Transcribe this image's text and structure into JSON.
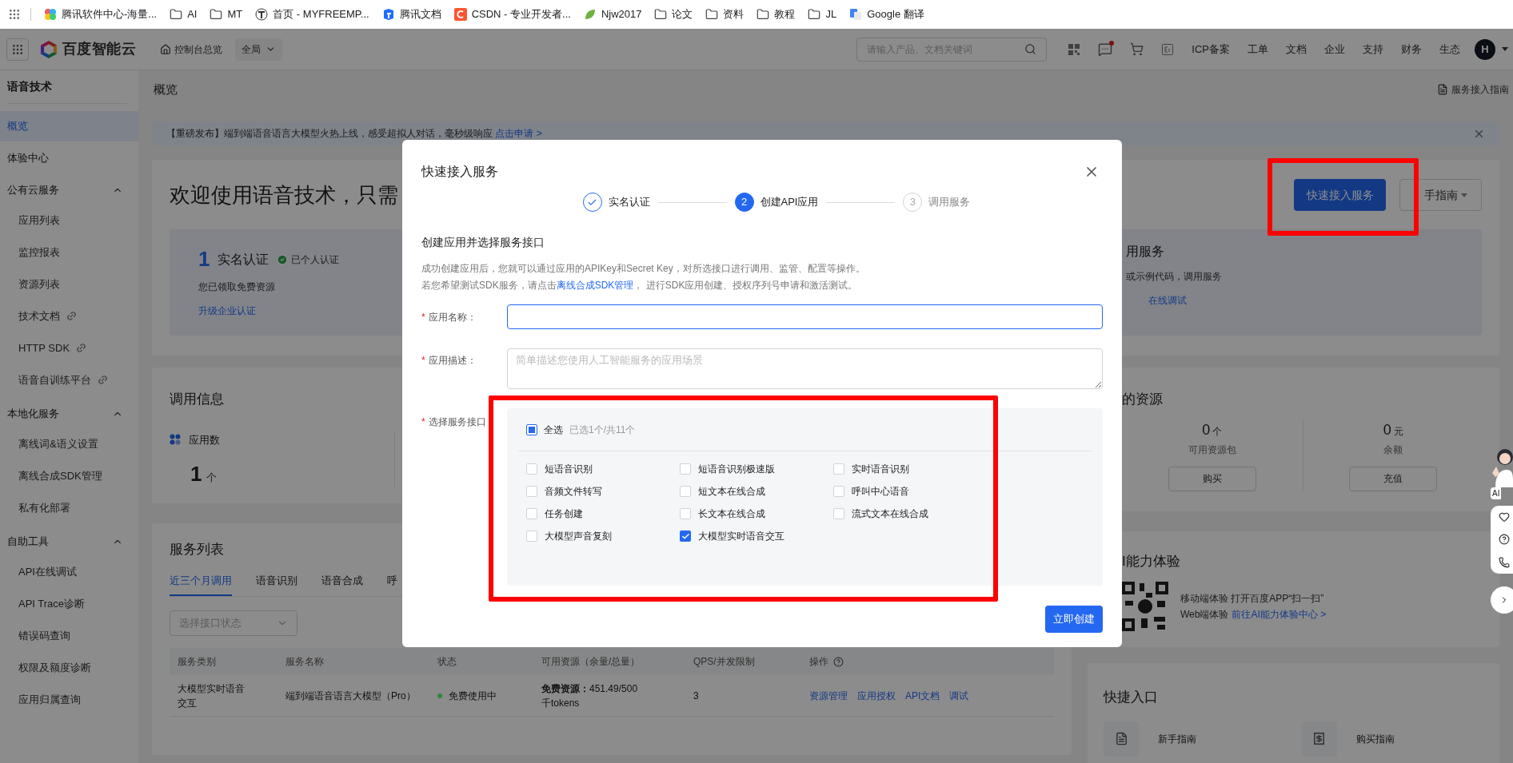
{
  "bookmarks": [
    {
      "label": "腾讯软件中心-海量...",
      "kind": "site"
    },
    {
      "label": "AI",
      "kind": "folder"
    },
    {
      "label": "MT",
      "kind": "folder"
    },
    {
      "label": "首页 - MYFREEMP...",
      "kind": "site"
    },
    {
      "label": "腾讯文档",
      "kind": "site"
    },
    {
      "label": "CSDN - 专业开发者...",
      "kind": "site"
    },
    {
      "label": "Njw2017",
      "kind": "site"
    },
    {
      "label": "论文",
      "kind": "folder"
    },
    {
      "label": "资料",
      "kind": "folder"
    },
    {
      "label": "教程",
      "kind": "folder"
    },
    {
      "label": "JL",
      "kind": "folder"
    },
    {
      "label": "Google 翻译",
      "kind": "site"
    }
  ],
  "header": {
    "logo": "百度智能云",
    "console": "控制台总览",
    "scope": "全局",
    "search_placeholder": "请输入产品、文档关键词",
    "message_unread": true,
    "nav": [
      "ICP备案",
      "工单",
      "文档",
      "企业",
      "支持",
      "财务",
      "生态"
    ],
    "avatar": "H"
  },
  "sidebar": {
    "title": "语音技术",
    "items": [
      {
        "label": "概览",
        "selected": true
      },
      {
        "label": "体验中心",
        "selected": false
      },
      {
        "label": "公有云服务",
        "selected": false,
        "expanded": true,
        "children": [
          {
            "label": "应用列表",
            "external": false
          },
          {
            "label": "监控报表",
            "external": false
          },
          {
            "label": "资源列表",
            "external": false
          },
          {
            "label": "技术文档",
            "external": true
          },
          {
            "label": "HTTP SDK",
            "external": true
          },
          {
            "label": "语音自训练平台",
            "external": true
          }
        ]
      },
      {
        "label": "本地化服务",
        "selected": false,
        "expanded": true,
        "children": [
          {
            "label": "离线词&语义设置",
            "external": false
          },
          {
            "label": "离线合成SDK管理",
            "external": false
          },
          {
            "label": "私有化部署",
            "external": false
          }
        ]
      },
      {
        "label": "自助工具",
        "selected": false,
        "expanded": true,
        "children": [
          {
            "label": "API在线调试",
            "external": false
          },
          {
            "label": "API Trace诊断",
            "external": false
          },
          {
            "label": "错误码查询",
            "external": false
          },
          {
            "label": "权限及额度诊断",
            "external": false
          },
          {
            "label": "应用归属查询",
            "external": false
          }
        ]
      }
    ]
  },
  "page": {
    "title": "概览",
    "guide_link": "服务接入指南",
    "banner": {
      "text": "【重磅发布】端到端语音语言大模型火热上线，感受超拟人对话，毫秒级响应",
      "link": "点击申请 >"
    },
    "welcome": {
      "title": "欢迎使用语音技术，只需",
      "primary_button": "快速接入服务",
      "guide_button": "手指南",
      "step_cards": [
        {
          "number": "1",
          "title": "实名认证",
          "status": "已个人认证",
          "text": "您已领取免费资源",
          "link": "升级企业认证"
        },
        {
          "title": "用服务",
          "text": "或示例代码，调用服务",
          "link": "在线调试"
        }
      ]
    },
    "usage": {
      "title": "调用信息",
      "metric": "应用数",
      "value": "1",
      "unit": "个"
    },
    "services": {
      "title": "服务列表",
      "tabs": [
        {
          "label": "近三个月调用",
          "selected": true
        },
        {
          "label": "语音识别",
          "selected": false
        },
        {
          "label": "语音合成",
          "selected": false
        },
        {
          "label": "呼",
          "selected": false
        }
      ],
      "filter_placeholder": "选择接口状态",
      "columns": [
        {
          "label": "服务类别",
          "help": false
        },
        {
          "label": "服务名称",
          "help": false
        },
        {
          "label": "状态",
          "help": false
        },
        {
          "label": "可用资源（余量/总量）",
          "help": false
        },
        {
          "label": "QPS/并发限制",
          "help": false
        },
        {
          "label": "操作",
          "help": true
        }
      ],
      "rows": [
        {
          "category": "大模型实时语音交互",
          "name": "端到端语音语言大模型（Pro）",
          "status": "免费使用中",
          "color": "#2a8a3c",
          "resource_label": "免费资源：",
          "resource": "451.49/500千tokens",
          "qps": "3",
          "actions": [
            "资源管理",
            "应用授权",
            "API文档",
            "调试"
          ]
        }
      ]
    },
    "resources": {
      "title": "的资源",
      "items": [
        {
          "value": "0",
          "unit": "个",
          "label": "可用资源包",
          "action": "购买"
        },
        {
          "value": "0",
          "unit": "元",
          "label": "余额",
          "action": "充值"
        }
      ]
    },
    "ai_experience": {
      "title": "I能力体验",
      "mobile": "移动端体验 打开百度APP“扫一扫”",
      "web_label": "Web端体验",
      "web_link": "前往AI能力体验中心 >"
    },
    "quick_entry": {
      "title": "快捷入口",
      "items": [
        {
          "label": "新手指南"
        },
        {
          "label": "购买指南"
        }
      ]
    },
    "assistant": {
      "label": "AI"
    }
  },
  "modal": {
    "title": "快速接入服务",
    "steps": [
      {
        "label": "实名认证",
        "done": true,
        "current": false
      },
      {
        "label": "创建API应用",
        "done": false,
        "current": true,
        "number": "2"
      },
      {
        "label": "调用服务",
        "done": false,
        "current": false,
        "number": "3"
      }
    ],
    "section_title": "创建应用并选择服务接口",
    "description": {
      "line1": "成功创建应用后，您就可以通过应用的APIKey和Secret Key，对所选接口进行调用、监管、配置等操作。",
      "before": "若您希望测试SDK服务，请点击",
      "link": "离线合成SDK管理",
      "after": "， 进行SDK应用创建、授权序列号申请和激活测试。"
    },
    "name_field": {
      "required_mark": "*",
      "label": "应用名称：",
      "focused": true
    },
    "desc_field": {
      "required_mark": "*",
      "label": "应用描述：",
      "placeholder": "简单描述您使用人工智能服务的应用场景"
    },
    "interfaces": {
      "required_mark": "*",
      "label": "选择服务接口",
      "select_all": {
        "label": "全选",
        "checked": false,
        "indeterminate": true
      },
      "summary": "已选1个/共11个",
      "options": [
        {
          "label": "短语音识别",
          "checked": false
        },
        {
          "label": "短语音识别极速版",
          "checked": false
        },
        {
          "label": "实时语音识别",
          "checked": false
        },
        {
          "label": "音频文件转写",
          "checked": false
        },
        {
          "label": "短文本在线合成",
          "checked": false
        },
        {
          "label": "呼叫中心语音",
          "checked": false
        },
        {
          "label": "任务创建",
          "checked": false
        },
        {
          "label": "长文本在线合成",
          "checked": false
        },
        {
          "label": "流式文本在线合成",
          "checked": false
        },
        {
          "label": "大模型声音复刻",
          "checked": false
        },
        {
          "label": "大模型实时语音交互",
          "checked": true
        }
      ]
    },
    "submit": "立即创建"
  },
  "highlights": {
    "interfaces_frame": true,
    "quick_access_frame": true
  }
}
